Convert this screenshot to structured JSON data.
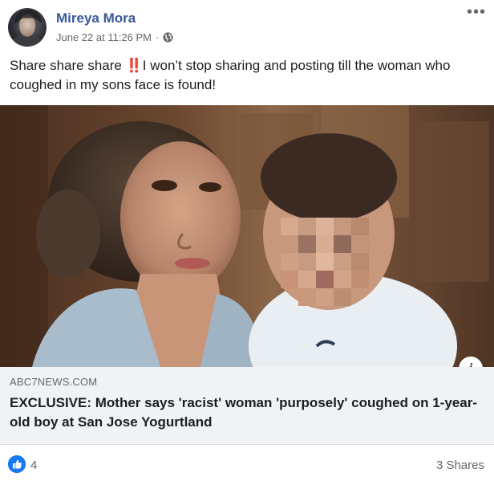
{
  "post": {
    "author": "Mireya Mora",
    "timestamp": "June 22 at 11:26 PM",
    "separator": "·",
    "privacy_icon": "globe-icon",
    "more_icon": "more-options-icon",
    "text_before": "Share share share ",
    "emoji": "‼️",
    "text_after": "I won’t stop sharing and posting till the woman who coughed in my sons face is found!"
  },
  "link_preview": {
    "domain": "ABC7NEWS.COM",
    "title": "EXCLUSIVE: Mother says 'racist' woman 'purposely' coughed on 1-year-old boy at San Jose Yogurtland",
    "info_icon": "info-icon"
  },
  "footer": {
    "reaction_icon": "like-icon",
    "reaction_count": "4",
    "shares": "3 Shares"
  },
  "colors": {
    "author_link": "#385898",
    "secondary_text": "#65676b",
    "like_blue": "#1877f2",
    "link_card_bg": "#f0f2f5"
  }
}
